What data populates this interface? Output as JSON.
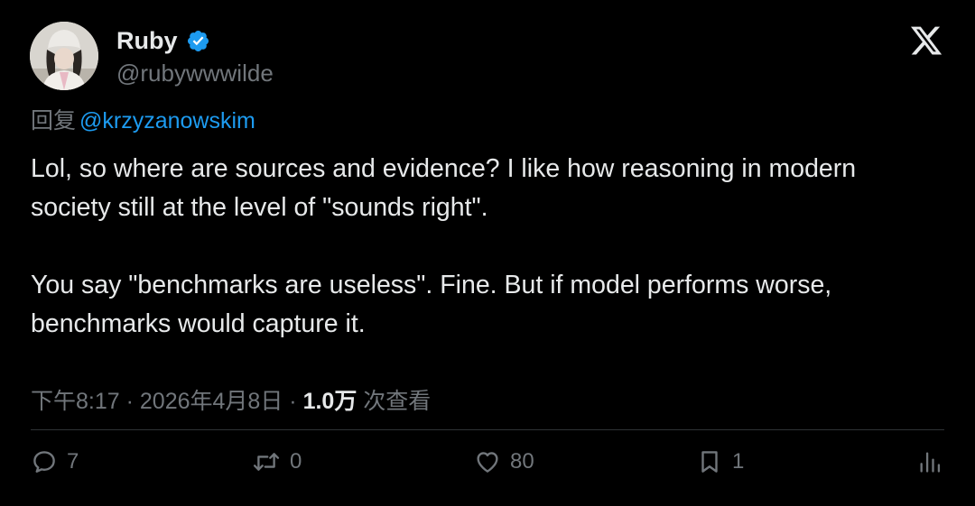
{
  "user": {
    "display_name": "Ruby",
    "handle": "@rubywwwilde",
    "avatar_icon": "avatar-photo"
  },
  "header": {
    "logo_icon": "x-logo-icon",
    "verified_icon": "verified-badge-icon"
  },
  "reply": {
    "prefix": "回复",
    "mention": "@krzyzanowskim"
  },
  "tweet": {
    "paragraphs": [
      "Lol, so where are sources and evidence? I like how reasoning in modern society still at the level of \"sounds right\".",
      "You say \"benchmarks are useless\". Fine. But if model performs worse, benchmarks would capture it."
    ]
  },
  "meta": {
    "time": "下午8:17",
    "separator": "·",
    "date": "2026年4月8日",
    "views_count": "1.0万",
    "views_label": "次查看"
  },
  "actions": {
    "replies": "7",
    "reposts": "0",
    "likes": "80",
    "bookmarks": "1"
  },
  "colors": {
    "background": "#000000",
    "text": "#e7e9ea",
    "muted": "#71767b",
    "accent": "#1d9bf0",
    "divider": "#2f3336"
  }
}
